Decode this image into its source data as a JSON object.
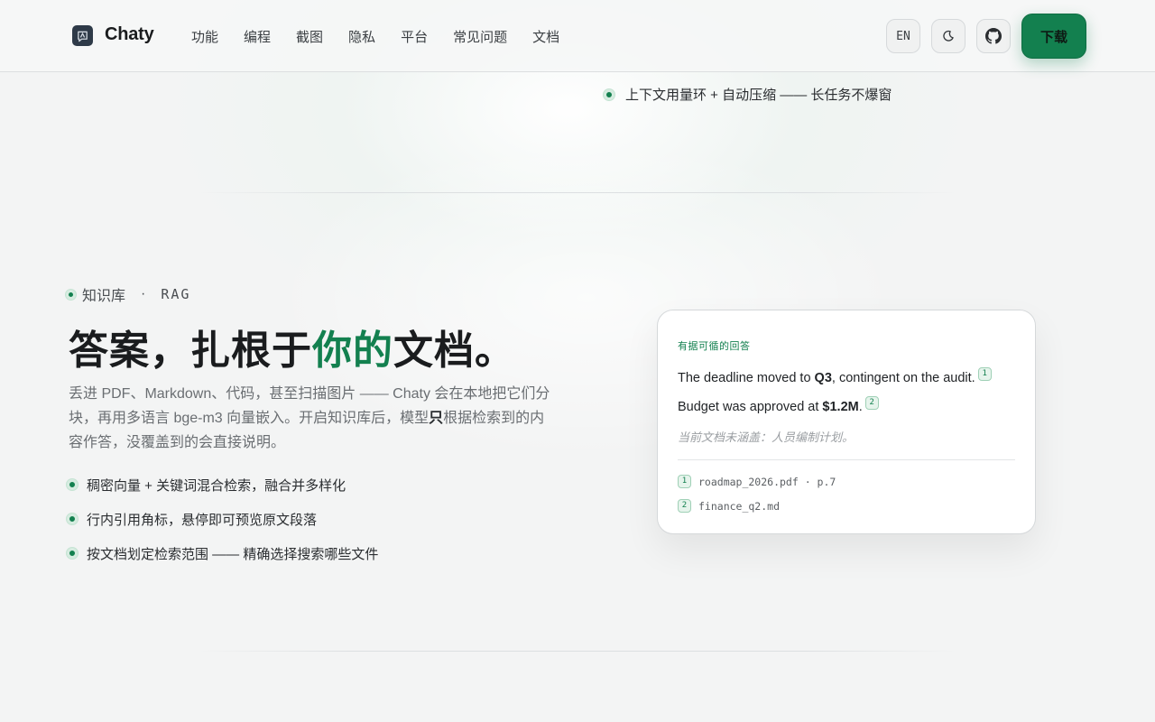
{
  "header": {
    "brand": "Chaty",
    "nav": [
      "功能",
      "编程",
      "截图",
      "隐私",
      "平台",
      "常见问题",
      "文档"
    ],
    "lang_label": "EN",
    "download_label": "下载",
    "icons": {
      "logo": "chaty-logo-icon",
      "theme": "moon-icon",
      "github": "github-icon"
    }
  },
  "prev_section": {
    "bullet": "上下文用量环 + 自动压缩 —— 长任务不爆窗"
  },
  "section": {
    "eyebrow_title": "知识库",
    "eyebrow_sep": "·",
    "eyebrow_tag": "RAG",
    "headline_pre": "答案，扎根于",
    "headline_accent": "你的",
    "headline_post": "文档。",
    "desc_pre": "丢进 PDF、Markdown、代码，甚至扫描图片 —— Chaty 会在本地把它们分块，再用多语言 bge-m3 向量嵌入。开启知识库后，模型",
    "desc_bold": "只",
    "desc_post": "根据检索到的内容作答，没覆盖到的会直接说明。",
    "features": [
      "稠密向量 + 关键词混合检索，融合并多样化",
      "行内引用角标，悬停即可预览原文段落",
      "按文档划定检索范围 —— 精确选择搜索哪些文件"
    ]
  },
  "card": {
    "label": "有据可循的回答",
    "line1_pre": "The deadline moved to ",
    "line1_bold": "Q3",
    "line1_post": ", contingent on the audit.",
    "line1_cite": "1",
    "line2_pre": "Budget was approved at ",
    "line2_bold": "$1.2M",
    "line2_post": ".",
    "line2_cite": "2",
    "missing": "当前文档未涵盖：人员编制计划。",
    "sources": [
      {
        "num": "1",
        "text": "roadmap_2026.pdf · p.7"
      },
      {
        "num": "2",
        "text": "finance_q2.md"
      }
    ]
  },
  "colors": {
    "accent": "#13804f",
    "accent_soft": "#e6f4ec",
    "text": "#1a1c1e",
    "muted": "#6a6e72"
  }
}
